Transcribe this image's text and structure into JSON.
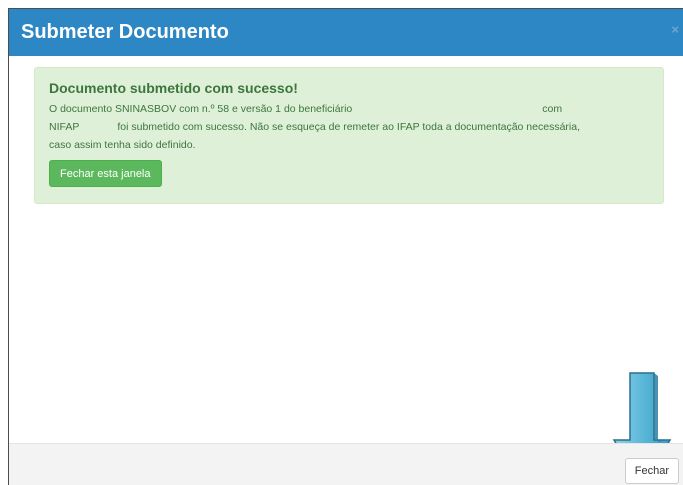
{
  "modal": {
    "title": "Submeter Documento",
    "close_glyph": "×"
  },
  "alert": {
    "heading": "Documento submetido com sucesso!",
    "line1_a": "O documento SNINASBOV com n.º 58 e versão 1 do beneficiário",
    "line1_b": "com",
    "line2_a": "NIFAP",
    "line2_b": "foi submetido com sucesso. Não se esqueça de remeter ao IFAP toda a documentação necessária,",
    "line3": "caso assim tenha sido definido.",
    "button_label": "Fechar esta janela"
  },
  "footer": {
    "close_label": "Fechar"
  },
  "annotation": {
    "icon": "arrow-down-icon",
    "color": "#5bb8d8"
  },
  "colors": {
    "header_bg": "#2c87c4",
    "alert_bg": "#dff0d8",
    "alert_text": "#3c763d",
    "success_button": "#5cb85c",
    "footer_bg": "#f3f3f3"
  }
}
